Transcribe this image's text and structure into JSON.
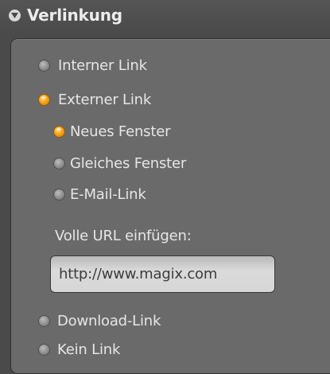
{
  "panel": {
    "title": "Verlinkung",
    "collapse_icon": "chevron-down-icon"
  },
  "link_options": {
    "internal": {
      "label": "Interner Link",
      "selected": false
    },
    "external": {
      "label": "Externer Link",
      "selected": true
    },
    "new_window": {
      "label": "Neues Fenster",
      "selected": true
    },
    "same_window": {
      "label": "Gleiches Fenster",
      "selected": false
    },
    "email": {
      "label": "E-Mail-Link",
      "selected": false
    },
    "download": {
      "label": "Download-Link",
      "selected": false
    },
    "none": {
      "label": "Kein Link",
      "selected": false
    }
  },
  "url_field": {
    "label": "Volle URL einfügen:",
    "value": "http://www.magix.com"
  },
  "colors": {
    "background": "#4a4a4a",
    "panel_body": "#6a6a6a",
    "radio_selected": "#f7a21a",
    "radio_unselected": "#9a9a9a",
    "text": "#e6e6e6"
  }
}
